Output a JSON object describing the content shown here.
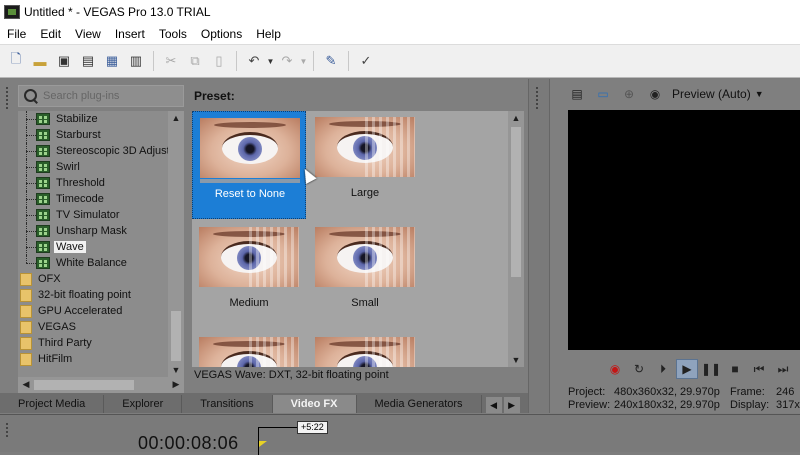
{
  "window": {
    "title": "Untitled * - VEGAS Pro 13.0 TRIAL"
  },
  "menu": [
    "File",
    "Edit",
    "View",
    "Insert",
    "Tools",
    "Options",
    "Help"
  ],
  "plugins": {
    "search_placeholder": "Search plug-ins",
    "fx_items": [
      "Stabilize",
      "Starburst",
      "Stereoscopic 3D Adjust",
      "Swirl",
      "Threshold",
      "Timecode",
      "TV Simulator",
      "Unsharp Mask",
      "Wave",
      "White Balance"
    ],
    "selected_item": "Wave",
    "folders": [
      "OFX",
      "32-bit floating point",
      "GPU Accelerated",
      "VEGAS",
      "Third Party",
      "HitFilm"
    ]
  },
  "presets": {
    "title": "Preset:",
    "items": [
      {
        "label": "Reset to None",
        "selected": true
      },
      {
        "label": "Large",
        "selected": false
      },
      {
        "label": "Medium",
        "selected": false
      },
      {
        "label": "Small",
        "selected": false
      },
      {
        "label": "",
        "selected": false
      },
      {
        "label": "",
        "selected": false
      }
    ],
    "status": "VEGAS Wave: DXT, 32-bit floating point"
  },
  "tabs": [
    {
      "label": "Project Media",
      "active": false
    },
    {
      "label": "Explorer",
      "active": false
    },
    {
      "label": "Transitions",
      "active": false
    },
    {
      "label": "Video FX",
      "active": true
    },
    {
      "label": "Media Generators",
      "active": false
    }
  ],
  "preview": {
    "mode_label": "Preview (Auto)",
    "info": {
      "project_label": "Project:",
      "project_value": "480x360x32, 29.970p",
      "frame_label": "Frame:",
      "frame_value": "246",
      "preview_label": "Preview:",
      "preview_value": "240x180x32, 29.970p",
      "display_label": "Display:",
      "display_value": "317x"
    }
  },
  "timeline": {
    "timecode": "00:00:08:06",
    "marker_label": "+5:22"
  },
  "colors": {
    "selection_blue": "#1c7ed6",
    "record_red": "#c41515",
    "folder_yellow": "#e8c36a"
  }
}
